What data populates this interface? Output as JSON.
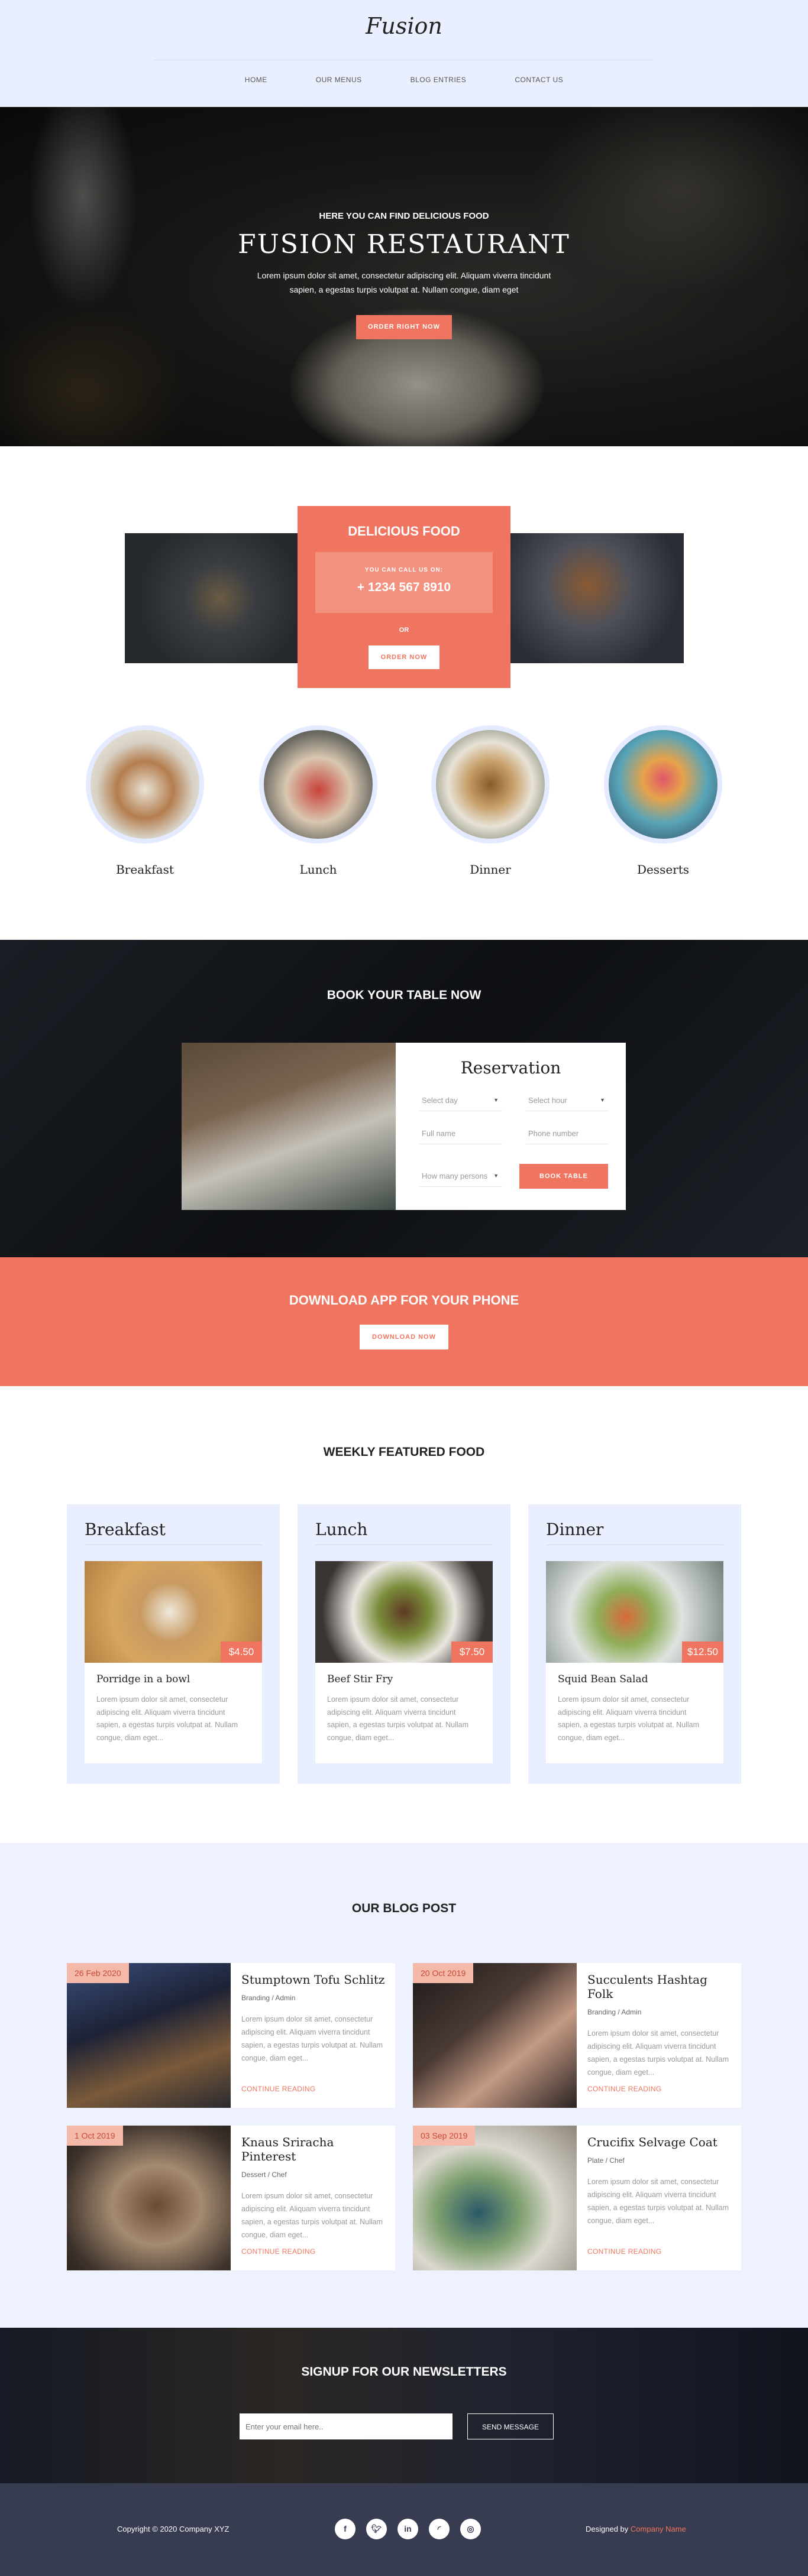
{
  "header": {
    "brand": "Fusion",
    "nav": [
      "HOME",
      "OUR MENUS",
      "BLOG ENTRIES",
      "CONTACT US"
    ]
  },
  "hero": {
    "subtitle": "HERE YOU CAN FIND DELICIOUS FOOD",
    "title": "FUSION RESTAURANT",
    "text": "Lorem ipsum dolor sit amet, consectetur adipiscing elit. Aliquam viverra tincidunt sapien, a egestas turpis volutpat at. Nullam congue, diam eget",
    "button": "ORDER RIGHT NOW"
  },
  "delicious": {
    "title": "DELICIOUS FOOD",
    "call_label": "YOU CAN CALL US ON:",
    "phone": "+ 1234 567 8910",
    "or": "OR",
    "button": "ORDER NOW"
  },
  "meals": [
    "Breakfast",
    "Lunch",
    "Dinner",
    "Desserts"
  ],
  "book": {
    "title": "BOOK YOUR TABLE NOW",
    "form_title": "Reservation",
    "day_placeholder": "Select day",
    "hour_placeholder": "Select hour",
    "name_placeholder": "Full name",
    "phone_placeholder": "Phone number",
    "persons_placeholder": "How many persons",
    "button": "BOOK TABLE"
  },
  "download": {
    "title": "DOWNLOAD APP FOR YOUR PHONE",
    "button": "DOWNLOAD NOW"
  },
  "weekly": {
    "title": "WEEKLY FEATURED FOOD",
    "cards": [
      {
        "category": "Breakfast",
        "name": "Porridge in a bowl",
        "price": "$4.50",
        "text": "Lorem ipsum dolor sit amet, consectetur adipiscing elit. Aliquam viverra tincidunt sapien, a egestas turpis volutpat at. Nullam congue, diam eget..."
      },
      {
        "category": "Lunch",
        "name": "Beef Stir Fry",
        "price": "$7.50",
        "text": "Lorem ipsum dolor sit amet, consectetur adipiscing elit. Aliquam viverra tincidunt sapien, a egestas turpis volutpat at. Nullam congue, diam eget..."
      },
      {
        "category": "Dinner",
        "name": "Squid Bean Salad",
        "price": "$12.50",
        "text": "Lorem ipsum dolor sit amet, consectetur adipiscing elit. Aliquam viverra tincidunt sapien, a egestas turpis volutpat at. Nullam congue, diam eget..."
      }
    ]
  },
  "blog": {
    "title": "OUR BLOG POST",
    "link_label": "CONTINUE READING",
    "posts": [
      {
        "date": "26 Feb 2020",
        "title": "Stumptown Tofu Schlitz",
        "meta": "Branding / Admin",
        "text": "Lorem ipsum dolor sit amet, consectetur adipiscing elit. Aliquam viverra tincidunt sapien, a egestas turpis volutpat at. Nullam congue, diam eget..."
      },
      {
        "date": "20 Oct 2019",
        "title": "Succulents Hashtag Folk",
        "meta": "Branding / Admin",
        "text": "Lorem ipsum dolor sit amet, consectetur adipiscing elit. Aliquam viverra tincidunt sapien, a egestas turpis volutpat at. Nullam congue, diam eget..."
      },
      {
        "date": "1 Oct 2019",
        "title": "Knaus Sriracha Pinterest",
        "meta": "Dessert / Chef",
        "text": "Lorem ipsum dolor sit amet, consectetur adipiscing elit. Aliquam viverra tincidunt sapien, a egestas turpis volutpat at. Nullam congue, diam eget..."
      },
      {
        "date": "03 Sep 2019",
        "title": "Crucifix Selvage Coat",
        "meta": "Plate / Chef",
        "text": "Lorem ipsum dolor sit amet, consectetur adipiscing elit. Aliquam viverra tincidunt sapien, a egestas turpis volutpat at. Nullam congue, diam eget..."
      }
    ]
  },
  "newsletter": {
    "title": "SIGNUP FOR OUR NEWSLETTERS",
    "placeholder": "Enter your email here..",
    "button": "SEND MESSAGE"
  },
  "footer": {
    "copyright": "Copyright © 2020 Company XYZ",
    "socials": [
      "f",
      "t",
      "in",
      "rss",
      "dribbble"
    ],
    "designed_prefix": "Designed by",
    "designed_name": "Company Name"
  },
  "colors": {
    "accent": "#f07560",
    "header_bg": "#eaefff",
    "footer_bg": "#383c51",
    "blog_bg": "#eef2ff"
  }
}
